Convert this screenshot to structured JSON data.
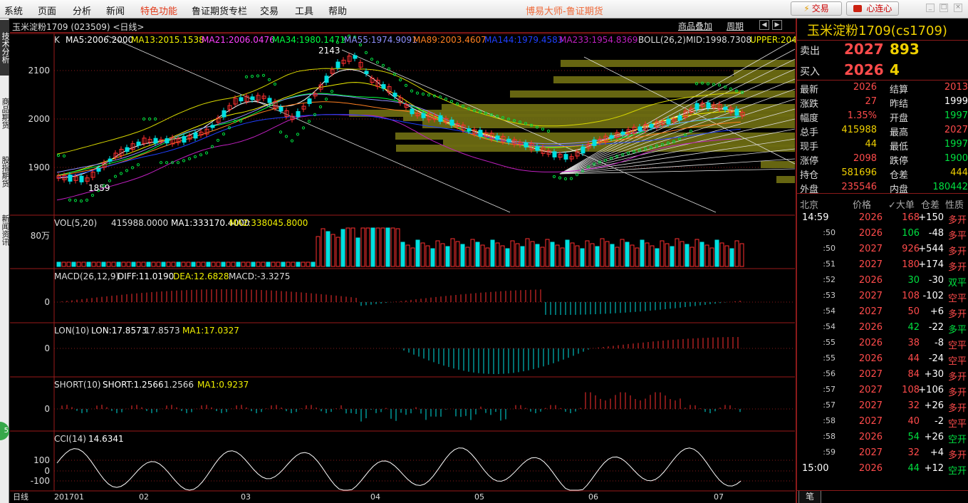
{
  "menu": [
    "系统",
    "页面",
    "分析",
    "新闻",
    "特色功能",
    "鲁证期货专栏",
    "交易",
    "工具",
    "帮助"
  ],
  "app_title": "博易大师-鲁证期货",
  "buttons": {
    "trade": "交易",
    "heart": "心连心"
  },
  "left_tabs": [
    "技术分析",
    "商品期货",
    "股指期货",
    "新闻资讯"
  ],
  "left_indicator": "5",
  "chart_header": {
    "contract": "玉米淀粉1709 (023509) <日线>",
    "overlay": "商品叠加",
    "cycle": "周期"
  },
  "main_indicators": [
    {
      "text": "K",
      "color": "#dddddd"
    },
    {
      "text": "MA5:2006.2000",
      "color": "#ffffff"
    },
    {
      "text": "MA13:2015.1538",
      "color": "#f0f000"
    },
    {
      "text": "MA21:2006.0476",
      "color": "#ff40ff"
    },
    {
      "text": "MA34:1980.1471",
      "color": "#00ff40"
    },
    {
      "text": "MA55:1974.9091",
      "color": "#9090ff"
    },
    {
      "text": "MA89:2003.4607",
      "color": "#ff8020"
    },
    {
      "text": "MA144:1979.4583",
      "color": "#2040ff"
    },
    {
      "text": "MA233:1954.8369",
      "color": "#c020c0"
    },
    {
      "text": "BOLL(26,2)",
      "color": "#dddddd"
    },
    {
      "text": "MID:1998.7308",
      "color": "#dddddd"
    },
    {
      "text": "UPPER:2046",
      "color": "#f0f000"
    }
  ],
  "peak_labels": {
    "high": "2143",
    "low": "1859"
  },
  "vol": {
    "label": "VOL(5,20)",
    "value": "415988.0000",
    "ma1": "MA1:333170.4000",
    "ma2": "MA2:338045.8000",
    "axis": "80万"
  },
  "macd": {
    "label": "MACD(26,12,9)",
    "diff": "DIFF:11.0190",
    "dea": "DEA:12.6828",
    "macd": "MACD:-3.3275"
  },
  "lon": {
    "label": "LON(10)",
    "lon": "LON:17.8573",
    "v2": "17.8573",
    "ma1": "MA1:17.0327"
  },
  "short": {
    "label": "SHORT(10)",
    "short": "SHORT:1.2566",
    "v2": "1.2566",
    "ma1": "MA1:0.9237"
  },
  "cci": {
    "label": "CCI(14)",
    "value": "14.6341"
  },
  "chart_data": {
    "type": "candlestick",
    "title": "玉米淀粉1709 (023509) <日线>",
    "price_axis_ticks": [
      "2100",
      "2000",
      "1900"
    ],
    "x_ticks": [
      "日线",
      "201701",
      "02",
      "03",
      "04",
      "05",
      "06",
      "07"
    ],
    "annotated_high": 2143,
    "annotated_low": 1859,
    "subpanel_zero_label": "0",
    "cci_ticks": [
      "100",
      "0",
      "-100"
    ]
  },
  "quote": {
    "title": "玉米淀粉1709(cs1709)",
    "sell": {
      "label": "卖出",
      "price": "2027",
      "vol": "893"
    },
    "buy": {
      "label": "买入",
      "price": "2026",
      "vol": "4"
    },
    "rows": [
      {
        "l1": "最新",
        "v1": "2026",
        "c1": "red",
        "l2": "结算",
        "v2": "2013",
        "c2": "red"
      },
      {
        "l1": "涨跌",
        "v1": "27",
        "c1": "red",
        "l2": "昨结",
        "v2": "1999",
        "c2": "white"
      },
      {
        "l1": "幅度",
        "v1": "1.35%",
        "c1": "red",
        "l2": "开盘",
        "v2": "1997",
        "c2": "green"
      },
      {
        "l1": "总手",
        "v1": "415988",
        "c1": "yellow",
        "l2": "最高",
        "v2": "2027",
        "c2": "red"
      },
      {
        "l1": "现手",
        "v1": "44",
        "c1": "yellow",
        "l2": "最低",
        "v2": "1997",
        "c2": "green"
      },
      {
        "l1": "涨停",
        "v1": "2098",
        "c1": "red",
        "l2": "跌停",
        "v2": "1900",
        "c2": "green"
      },
      {
        "l1": "持仓",
        "v1": "581696",
        "c1": "yellow",
        "l2": "仓差",
        "v2": "444",
        "c2": "yellow"
      },
      {
        "l1": "外盘",
        "v1": "235546",
        "c1": "red",
        "l2": "内盘",
        "v2": "180442",
        "c2": "green"
      }
    ],
    "tick_headers": [
      "北京",
      "价格",
      "✓大单",
      "仓差",
      "性质"
    ],
    "ticks": [
      {
        "t": "14:59",
        "big": true,
        "p": "2026",
        "pc": "red",
        "v": "168",
        "vc": "red",
        "d": "+150",
        "dc": "white",
        "n": "多开",
        "nc": "red"
      },
      {
        "t": ":50",
        "p": "2026",
        "pc": "red",
        "v": "106",
        "vc": "green",
        "d": "-48",
        "dc": "white",
        "n": "多平",
        "nc": "red"
      },
      {
        "t": ":50",
        "p": "2027",
        "pc": "red",
        "v": "926",
        "vc": "red",
        "d": "+544",
        "dc": "white",
        "n": "多开",
        "nc": "red"
      },
      {
        "t": ":51",
        "p": "2027",
        "pc": "red",
        "v": "180",
        "vc": "red",
        "d": "+174",
        "dc": "white",
        "n": "多开",
        "nc": "red"
      },
      {
        "t": ":52",
        "p": "2026",
        "pc": "red",
        "v": "30",
        "vc": "green",
        "d": "-30",
        "dc": "white",
        "n": "双平",
        "nc": "green"
      },
      {
        "t": ":53",
        "p": "2027",
        "pc": "red",
        "v": "108",
        "vc": "red",
        "d": "-102",
        "dc": "white",
        "n": "空平",
        "nc": "red"
      },
      {
        "t": ":54",
        "p": "2027",
        "pc": "red",
        "v": "50",
        "vc": "red",
        "d": "+6",
        "dc": "white",
        "n": "多开",
        "nc": "red"
      },
      {
        "t": ":54",
        "p": "2026",
        "pc": "red",
        "v": "42",
        "vc": "green",
        "d": "-22",
        "dc": "white",
        "n": "多平",
        "nc": "green"
      },
      {
        "t": ":55",
        "p": "2026",
        "pc": "red",
        "v": "38",
        "vc": "red",
        "d": "-8",
        "dc": "white",
        "n": "空平",
        "nc": "red"
      },
      {
        "t": ":55",
        "p": "2026",
        "pc": "red",
        "v": "44",
        "vc": "red",
        "d": "-24",
        "dc": "white",
        "n": "空平",
        "nc": "red"
      },
      {
        "t": ":56",
        "p": "2027",
        "pc": "red",
        "v": "84",
        "vc": "red",
        "d": "+30",
        "dc": "white",
        "n": "多开",
        "nc": "red"
      },
      {
        "t": ":57",
        "p": "2027",
        "pc": "red",
        "v": "108",
        "vc": "red",
        "d": "+106",
        "dc": "white",
        "n": "多开",
        "nc": "red"
      },
      {
        "t": ":57",
        "p": "2027",
        "pc": "red",
        "v": "32",
        "vc": "red",
        "d": "+26",
        "dc": "white",
        "n": "多开",
        "nc": "red"
      },
      {
        "t": ":58",
        "p": "2027",
        "pc": "red",
        "v": "40",
        "vc": "red",
        "d": "-2",
        "dc": "white",
        "n": "空平",
        "nc": "red"
      },
      {
        "t": ":58",
        "p": "2026",
        "pc": "red",
        "v": "54",
        "vc": "green",
        "d": "+26",
        "dc": "white",
        "n": "空开",
        "nc": "green"
      },
      {
        "t": ":59",
        "p": "2027",
        "pc": "red",
        "v": "32",
        "vc": "red",
        "d": "+4",
        "dc": "white",
        "n": "多开",
        "nc": "red"
      },
      {
        "t": "15:00",
        "big": true,
        "p": "2026",
        "pc": "red",
        "v": "44",
        "vc": "green",
        "d": "+12",
        "dc": "white",
        "n": "空开",
        "nc": "green"
      }
    ],
    "bottom_tab": "笔"
  }
}
